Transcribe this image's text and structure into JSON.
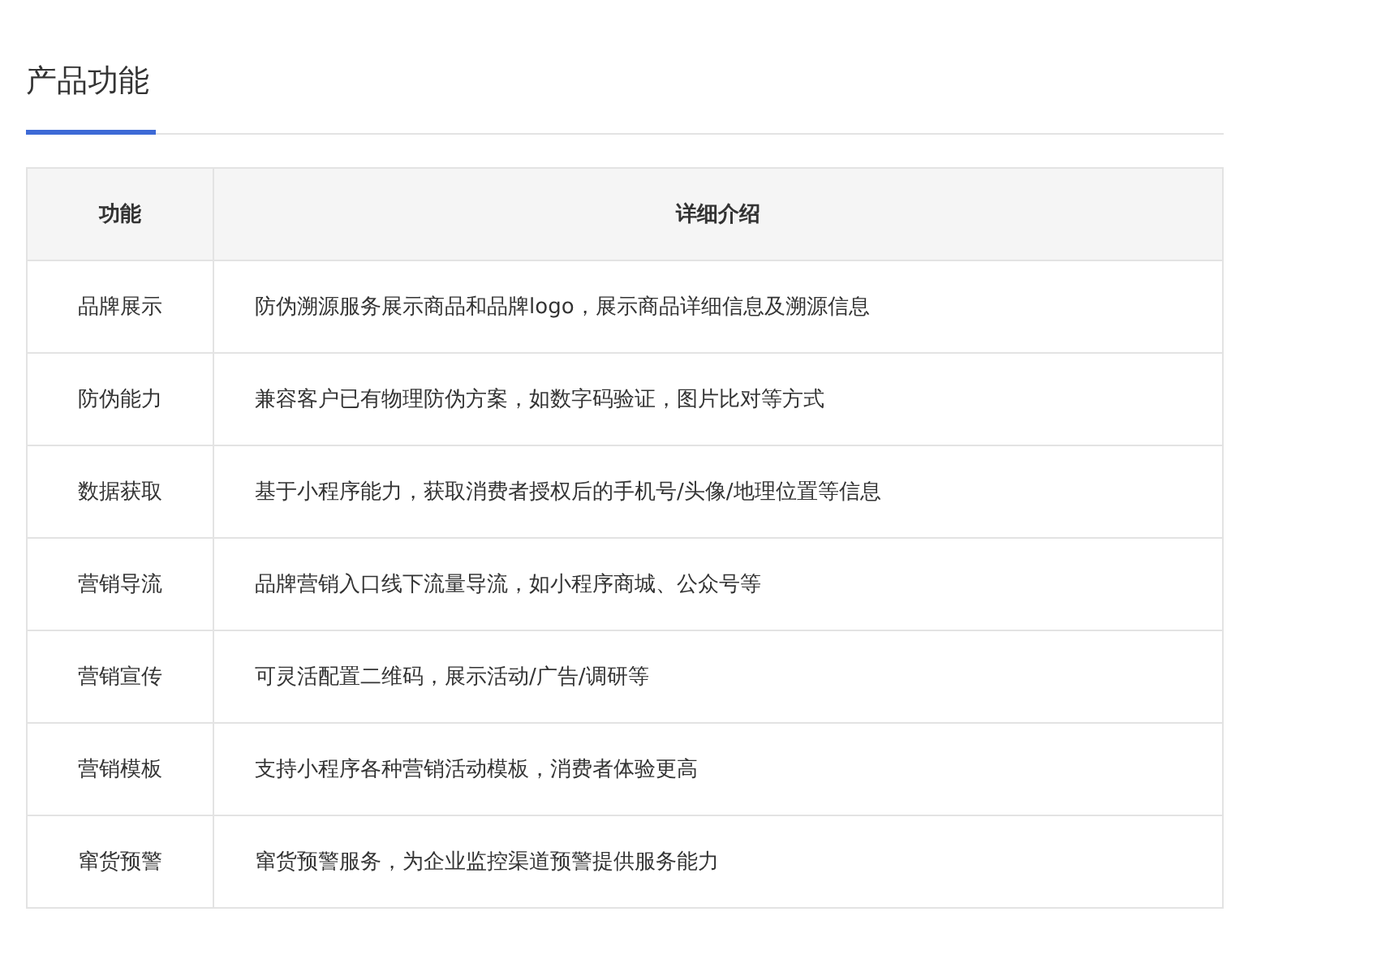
{
  "title": "产品功能",
  "table": {
    "columns": [
      "功能",
      "详细介绍"
    ],
    "rows": [
      [
        "品牌展示",
        "防伪溯源服务展示商品和品牌logo，展示商品详细信息及溯源信息"
      ],
      [
        "防伪能力",
        "兼容客户已有物理防伪方案，如数字码验证，图片比对等方式"
      ],
      [
        "数据获取",
        "基于小程序能力，获取消费者授权后的手机号/头像/地理位置等信息"
      ],
      [
        "营销导流",
        "品牌营销入口线下流量导流，如小程序商城、公众号等"
      ],
      [
        "营销宣传",
        "可灵活配置二维码，展示活动/广告/调研等"
      ],
      [
        "营销模板",
        "支持小程序各种营销活动模板，消费者体验更高"
      ],
      [
        "窜货预警",
        "窜货预警服务，为企业监控渠道预警提供服务能力"
      ]
    ]
  }
}
